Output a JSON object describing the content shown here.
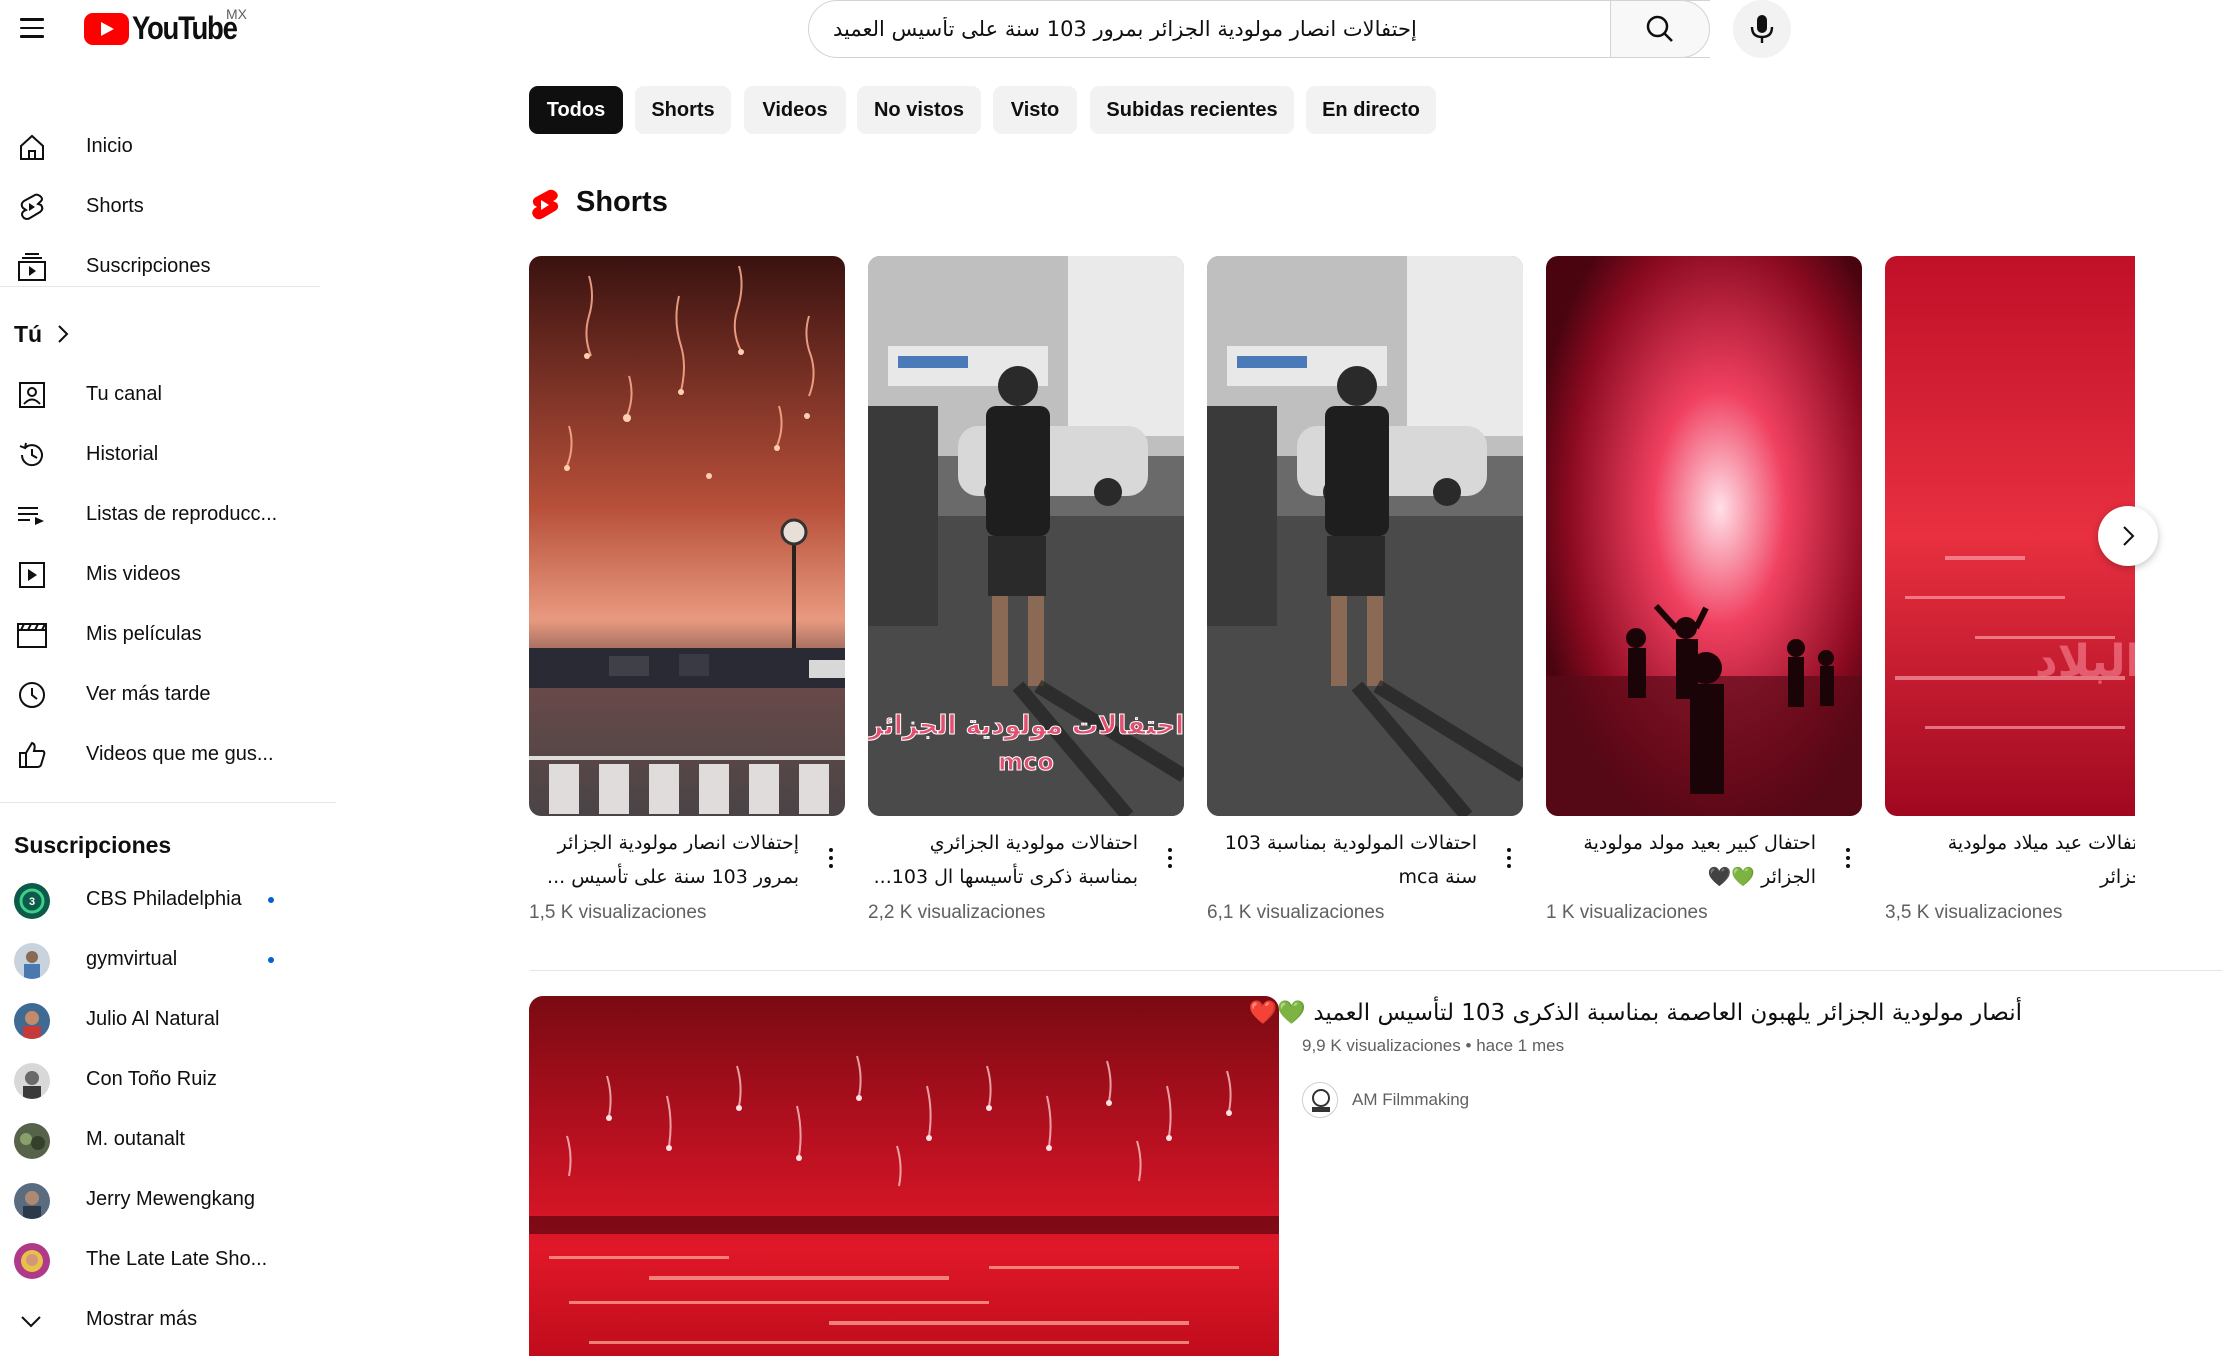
{
  "header": {
    "logo_text": "YouTube",
    "country": "MX",
    "search_value": "إحتفالات انصار مولودية الجزائر بمرور 103 سنة على تأسيس العميد"
  },
  "sidebar": {
    "main": [
      {
        "label": "Inicio",
        "icon": "home-icon"
      },
      {
        "label": "Shorts",
        "icon": "shorts-icon"
      },
      {
        "label": "Suscripciones",
        "icon": "subscriptions-icon"
      }
    ],
    "you_title": "Tú",
    "you_items": [
      {
        "label": "Tu canal",
        "icon": "channel-icon"
      },
      {
        "label": "Historial",
        "icon": "history-icon"
      },
      {
        "label": "Listas de reproducc...",
        "icon": "playlists-icon"
      },
      {
        "label": "Mis videos",
        "icon": "my-videos-icon"
      },
      {
        "label": "Mis películas",
        "icon": "movies-icon"
      },
      {
        "label": "Ver más tarde",
        "icon": "watch-later-icon"
      },
      {
        "label": "Videos que me gus...",
        "icon": "liked-icon"
      }
    ],
    "subs_title": "Suscripciones",
    "subscriptions": [
      {
        "name": "CBS Philadelphia",
        "new": true,
        "color": "#0c5a4a"
      },
      {
        "name": "gymvirtual",
        "new": true,
        "color": "#7a8aa0"
      },
      {
        "name": "Julio Al Natural",
        "new": false,
        "color": "#4a6a8a"
      },
      {
        "name": "Con Toño Ruiz",
        "new": false,
        "color": "#9a9a9a"
      },
      {
        "name": "M. outanalt",
        "new": false,
        "color": "#5a6a4a"
      },
      {
        "name": "Jerry Mewengkang",
        "new": false,
        "color": "#6a7a8a"
      },
      {
        "name": "The Late Late Sho...",
        "new": false,
        "color": "#b03a8a"
      }
    ],
    "show_more": "Mostrar más"
  },
  "chips": [
    "Todos",
    "Shorts",
    "Videos",
    "No vistos",
    "Visto",
    "Subidas recientes",
    "En directo"
  ],
  "shorts": {
    "title": "Shorts",
    "items": [
      {
        "title_lines": [
          "إحتفالات انصار مولودية الجزائر",
          "بمرور 103 سنة على تأسيس ..."
        ],
        "views": "1,5 K visualizaciones",
        "overlay": ""
      },
      {
        "title_lines": [
          "احتفالات مولودية الجزائري",
          "بمناسبة ذكرى تأسيسها ال 103..."
        ],
        "views": "2,2 K visualizaciones",
        "overlay": "احتفالات مولودية الجزائر mco"
      },
      {
        "title_lines": [
          "احتفالات المولودية بمناسبة 103",
          "سنة mca"
        ],
        "views": "6,1 K visualizaciones",
        "overlay": ""
      },
      {
        "title_lines": [
          "احتفال كبير بعيد مولد مولودية",
          "الجزائر 💚🖤"
        ],
        "views": "1 K visualizaciones",
        "overlay": ""
      },
      {
        "title_lines": [
          "احتفالات عيد ميلاد مولودية",
          "الجزائر"
        ],
        "views": "3,5 K visualizaciones",
        "overlay": ""
      }
    ]
  },
  "video": {
    "title": "أنصار مولودية الجزائر يلهبون العاصمة بمناسبة الذكرى 103 لتأسيس العميد 💚❤️",
    "views": "9,9 K visualizaciones",
    "age": "hace 1 mes",
    "channel": "AM Filmmaking"
  }
}
